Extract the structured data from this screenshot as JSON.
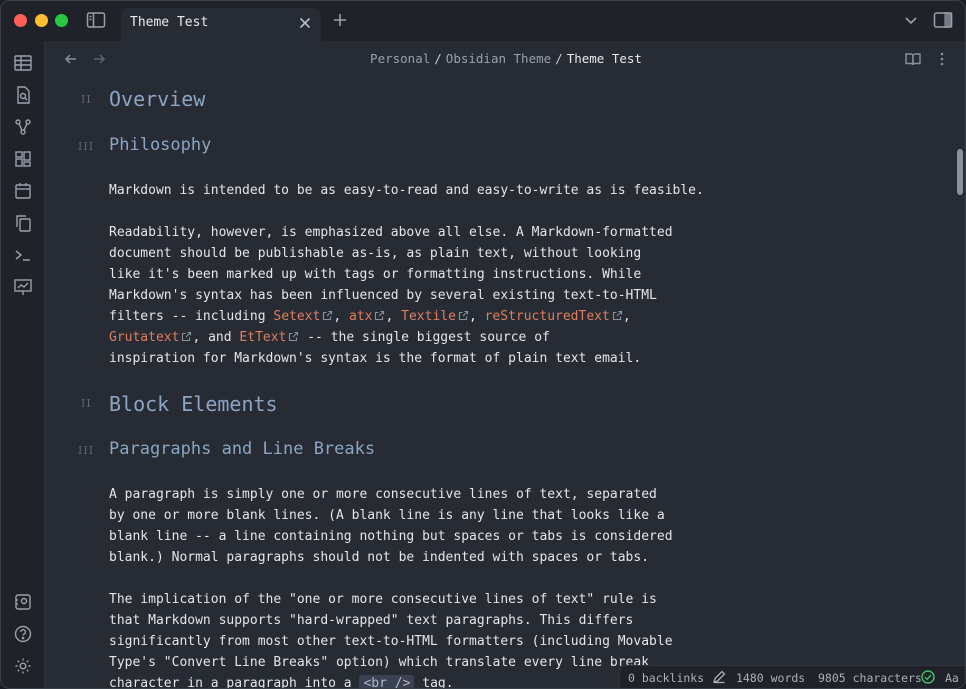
{
  "tab": {
    "title": "Theme Test"
  },
  "breadcrumb": {
    "parts": [
      "Personal",
      "Obsidian Theme",
      "Theme Test"
    ],
    "separator": "/"
  },
  "heading_markers": {
    "h2": "II",
    "h3": "III"
  },
  "doc": {
    "h_overview": "Overview",
    "h_philosophy": "Philosophy",
    "p1": "Markdown is intended to be as easy-to-read and easy-to-write as is feasible.",
    "p2": {
      "l1": "Readability, however, is emphasized above all else. A Markdown-formatted",
      "l2": "document should be publishable as-is, as plain text, without looking",
      "l3": "like it's been marked up with tags or formatting instructions. While",
      "l4": "Markdown's syntax has been influenced by several existing text-to-HTML",
      "l5_pre": "filters -- including ",
      "link_setext": "Setext",
      "link_atx": "atx",
      "link_textile": "Textile",
      "link_rst": "reStructuredText",
      "link_grutatext": "Grutatext",
      "l6_and": ", and ",
      "link_ettext": "EtText",
      "l6_post": " -- the single biggest source of",
      "l7": "inspiration for Markdown's syntax is the format of plain text email.",
      "comma": ", "
    },
    "h_block": "Block Elements",
    "h_paragraphs": "Paragraphs and Line Breaks",
    "p3": {
      "l1": "A paragraph is simply one or more consecutive lines of text, separated",
      "l2": "by one or more blank lines. (A blank line is any line that looks like a",
      "l3": "blank line -- a line containing nothing but spaces or tabs is considered",
      "l4": "blank.) Normal paragraphs should not be indented with spaces or tabs."
    },
    "p4": {
      "l1": "The implication of the \"one or more consecutive lines of text\" rule is",
      "l2": "that Markdown supports \"hard-wrapped\" text paragraphs. This differs",
      "l3": "significantly from most other text-to-HTML formatters (including Movable",
      "l4": "Type's \"Convert Line Breaks\" option) which translate every line break",
      "l5_pre": "character in a paragraph into a ",
      "code_br": "<br />",
      "l5_post": " tag."
    }
  },
  "status": {
    "backlinks": "0 backlinks",
    "words": "1480 words",
    "characters": "9805 characters",
    "font_toggle": "Aa"
  },
  "colors": {
    "heading": "#8ba5c4",
    "link": "#e07e5f",
    "background": "#272b33",
    "sync_ok": "#3ec46d"
  }
}
